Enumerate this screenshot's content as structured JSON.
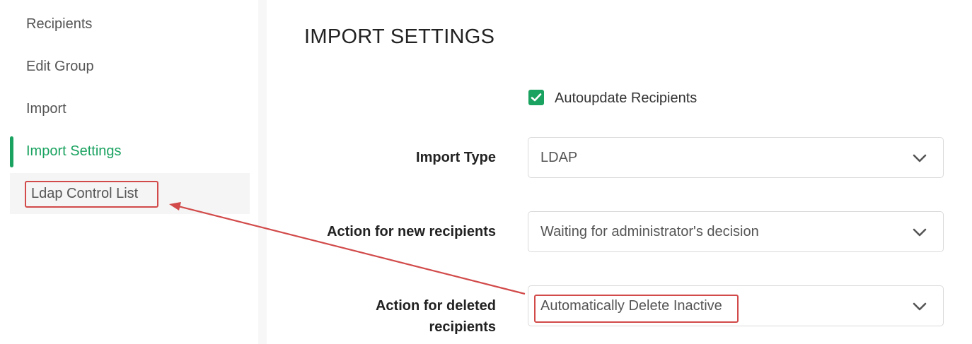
{
  "sidebar": {
    "items": [
      {
        "label": "Recipients"
      },
      {
        "label": "Edit Group"
      },
      {
        "label": "Import"
      },
      {
        "label": "Import Settings",
        "active": true
      },
      {
        "label": "Ldap Control List"
      }
    ]
  },
  "main": {
    "title": "IMPORT SETTINGS",
    "autoupdate": {
      "label": "Autoupdate Recipients",
      "checked": true
    },
    "fields": [
      {
        "label": "Import Type",
        "value": "LDAP"
      },
      {
        "label": "Action for new recipients",
        "value": "Waiting for administrator's decision"
      },
      {
        "label_line1": "Action for deleted",
        "label_line2": "recipients",
        "value": "Automatically Delete Inactive"
      }
    ]
  },
  "colors": {
    "accent": "#1aa260",
    "annotation": "#d24a4a"
  },
  "icons": {
    "checkbox": "check-icon",
    "dropdown": "chevron-down-icon"
  }
}
